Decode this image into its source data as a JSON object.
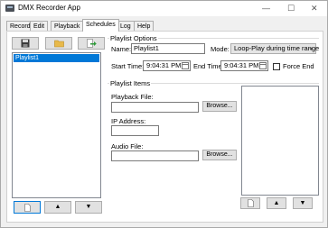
{
  "window": {
    "title": "DMX Recorder App",
    "controls": {
      "minimize": "—",
      "maximize": "☐",
      "close": "✕"
    }
  },
  "tabs": [
    {
      "label": "Record"
    },
    {
      "label": "Edit"
    },
    {
      "label": "Playback"
    },
    {
      "label": "Schedules"
    },
    {
      "label": "Log"
    },
    {
      "label": "Help"
    }
  ],
  "active_tab": "Schedules",
  "toolbar": {
    "icons": [
      "save-icon",
      "folder-icon",
      "export-icon"
    ]
  },
  "playlists": {
    "items": [
      "Playlist1"
    ],
    "selected": "Playlist1"
  },
  "left_buttons": {
    "icons": [
      "new-document-icon",
      "up-arrow-icon",
      "down-arrow-icon"
    ],
    "up": "▲",
    "down": "▼"
  },
  "options": {
    "group": "Playlist Options",
    "name_label": "Name:",
    "name_value": "Playlist1",
    "mode_label": "Mode:",
    "mode_value": "Loop-Play during time range",
    "start_label": "Start Time:",
    "start_value": "9:04:31 PM",
    "end_label": "End Time:",
    "end_value": "9:04:31 PM",
    "force_end_label": "Force End"
  },
  "items": {
    "group": "Playlist Items",
    "playback_label": "Playback File:",
    "playback_value": "",
    "browse1": "Browse...",
    "ip_label": "IP Address:",
    "ip_value": "",
    "audio_label": "Audio File:",
    "audio_value": "",
    "browse2": "Browse..."
  },
  "right_buttons": {
    "up": "▲",
    "down": "▼"
  },
  "colors": {
    "selection": "#0078d7",
    "window_bg": "#f0f0f0",
    "panel_bg": "#ffffff"
  }
}
